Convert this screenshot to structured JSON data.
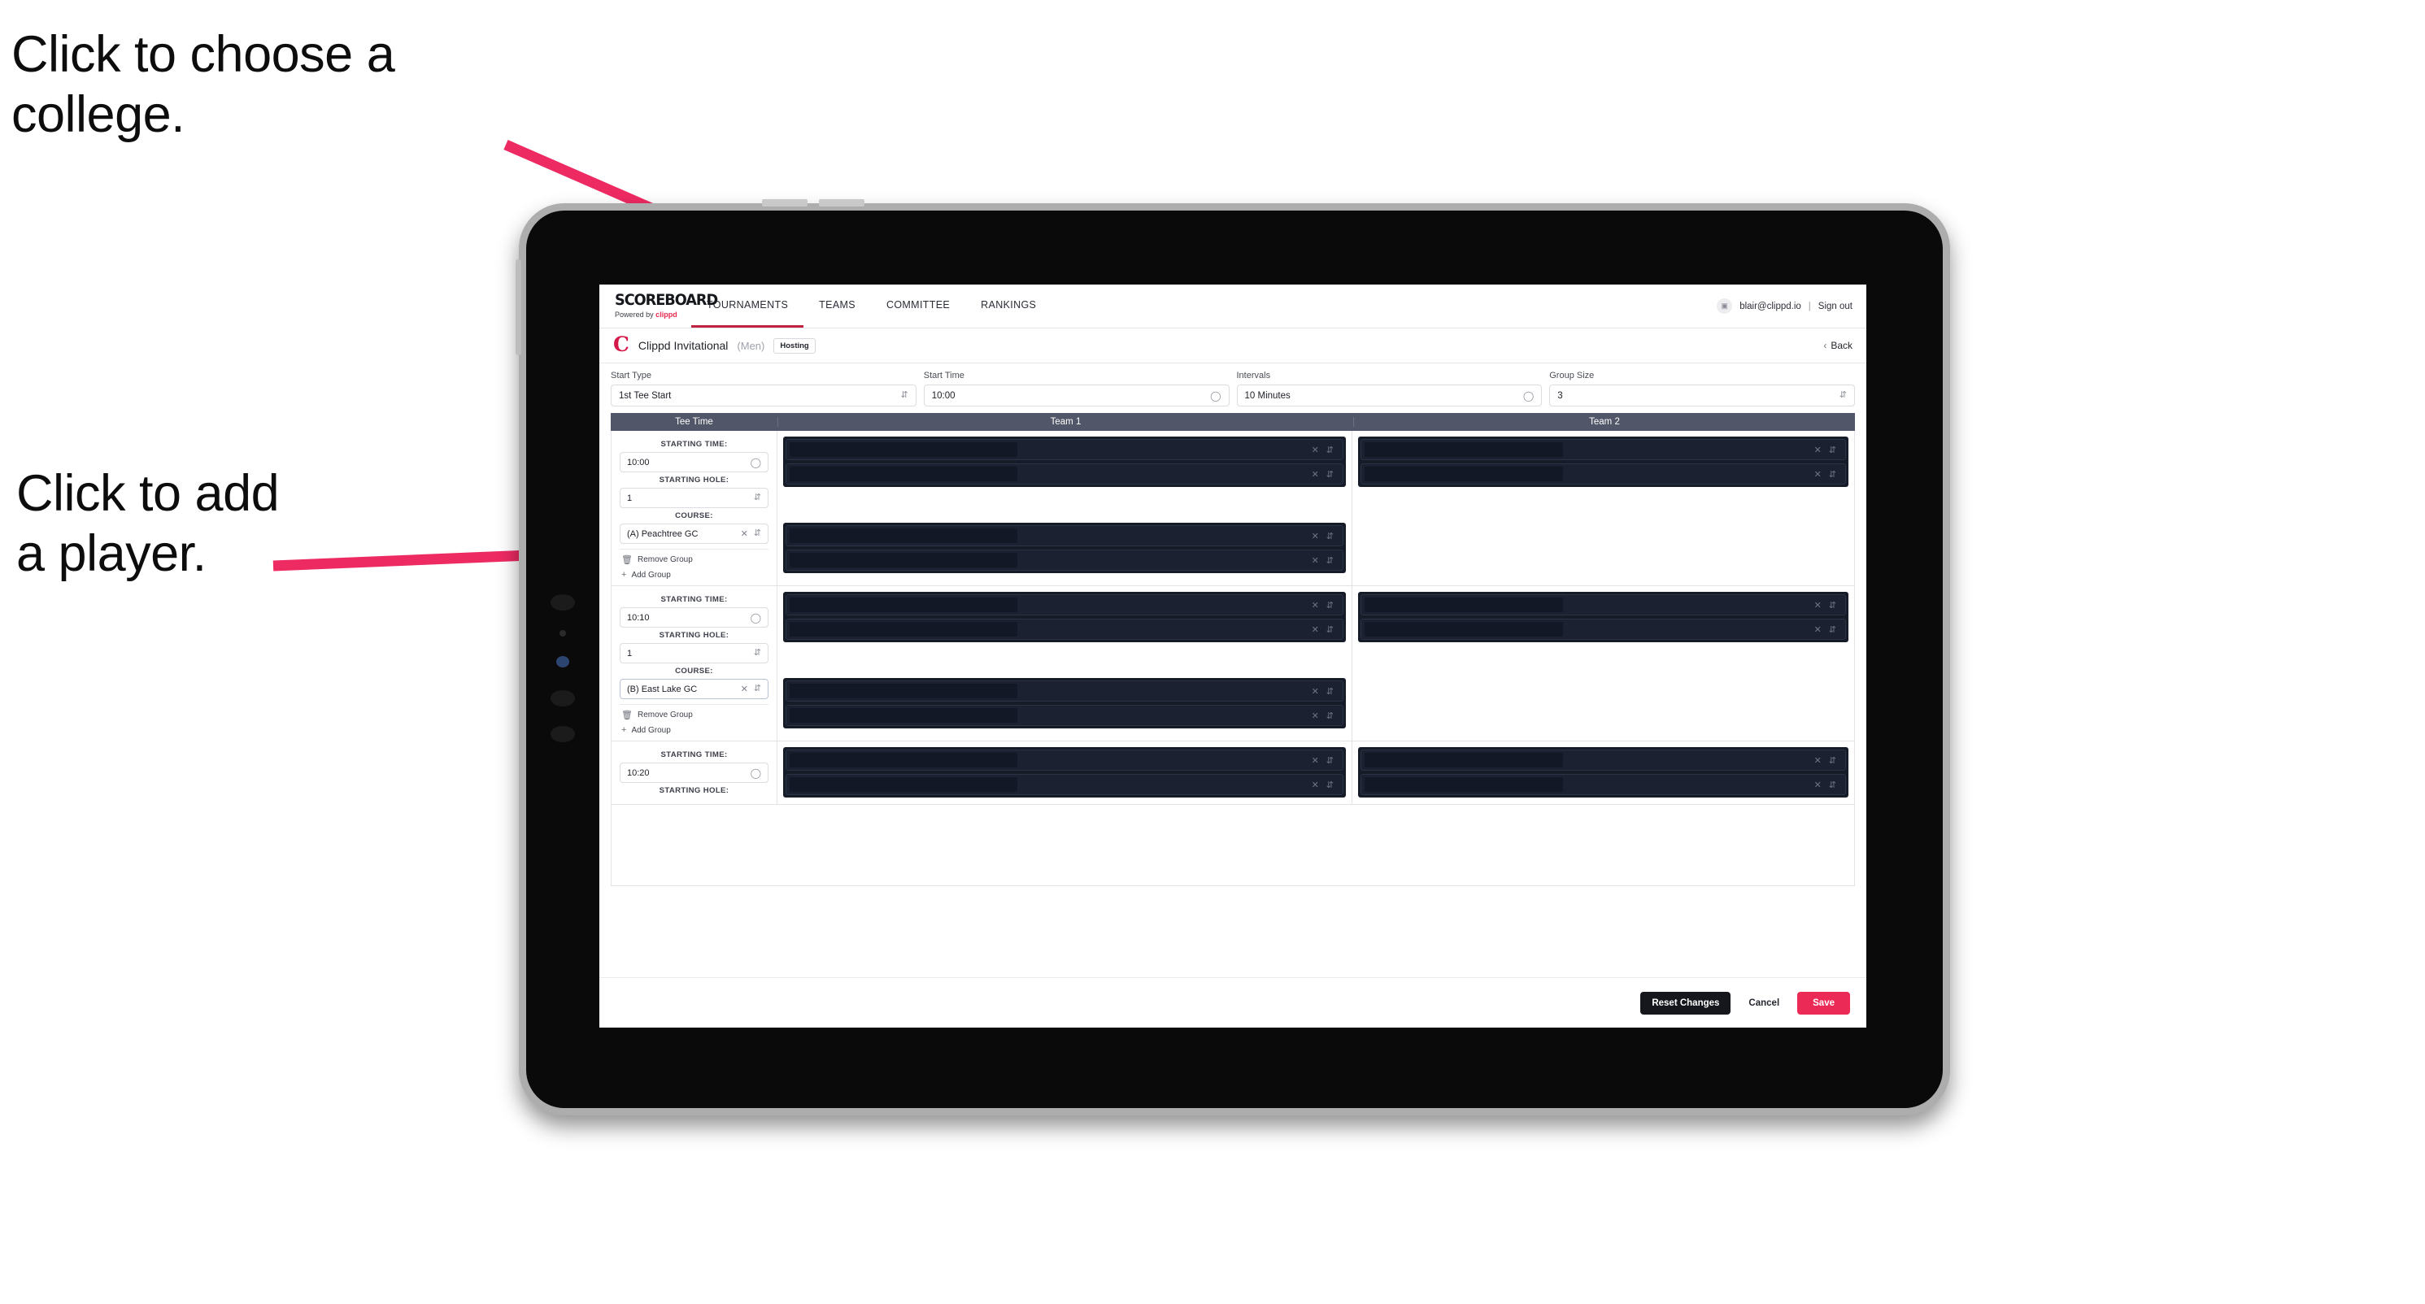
{
  "annotations": {
    "college": "Click to choose a\ncollege.",
    "player": "Click to add\na player."
  },
  "app": {
    "brand": {
      "word": "SCOREBOARD",
      "powered_prefix": "Powered by ",
      "powered_name": "clippd"
    },
    "nav": [
      {
        "label": "TOURNAMENTS",
        "active": true
      },
      {
        "label": "TEAMS",
        "active": false
      },
      {
        "label": "COMMITTEE",
        "active": false
      },
      {
        "label": "RANKINGS",
        "active": false
      }
    ],
    "user": {
      "avatar_icon": "user-avatar-icon",
      "email": "blair@clippd.io",
      "separator": "|",
      "sign_out": "Sign out"
    },
    "tournament": {
      "logo": "C",
      "name": "Clippd Invitational",
      "gender": "(Men)",
      "badge": "Hosting",
      "back": "Back",
      "back_icon": "chevron-left-icon"
    },
    "settings": [
      {
        "label": "Start Type",
        "value": "1st Tee Start",
        "control": "select",
        "icon": "chevron-updown-icon"
      },
      {
        "label": "Start Time",
        "value": "10:00",
        "control": "time",
        "icon": "clock-icon"
      },
      {
        "label": "Intervals",
        "value": "10 Minutes",
        "control": "time",
        "icon": "clock-icon"
      },
      {
        "label": "Group Size",
        "value": "3",
        "control": "select",
        "icon": "chevron-updown-icon"
      }
    ],
    "table": {
      "headers": [
        "Tee Time",
        "Team 1",
        "Team 2"
      ],
      "field_labels": {
        "time": "STARTING TIME:",
        "hole": "STARTING HOLE:",
        "course": "COURSE:"
      },
      "group_actions": {
        "remove": "Remove Group",
        "remove_icon": "trash-icon",
        "add": "Add Group",
        "add_icon": "plus-icon"
      },
      "player_row_icons": {
        "clear": "clear-x-icon",
        "reorder": "chevron-updown-icon"
      },
      "groups": [
        {
          "starting_time": "10:00",
          "starting_hole": "1",
          "course": "(A) Peachtree GC",
          "course_focused": false,
          "team1_players": [
            "",
            ""
          ],
          "team2_players": [
            "",
            ""
          ]
        },
        {
          "starting_time": "10:10",
          "starting_hole": "1",
          "course": "(B) East Lake GC",
          "course_focused": true,
          "team1_players": [
            "",
            ""
          ],
          "team2_players": [
            "",
            ""
          ]
        },
        {
          "starting_time": "10:20",
          "starting_hole": "",
          "course": "",
          "course_focused": false,
          "team1_players": [
            "",
            ""
          ],
          "team2_players": [
            "",
            ""
          ]
        }
      ]
    },
    "footer": {
      "reset": "Reset Changes",
      "cancel": "Cancel",
      "save": "Save"
    }
  },
  "colors": {
    "accent_pink": "#ec2a56",
    "brand_red": "#d4184a",
    "table_header": "#515668",
    "redact_dark": "#161b28",
    "annotation_arrow": "#ee2a63"
  }
}
